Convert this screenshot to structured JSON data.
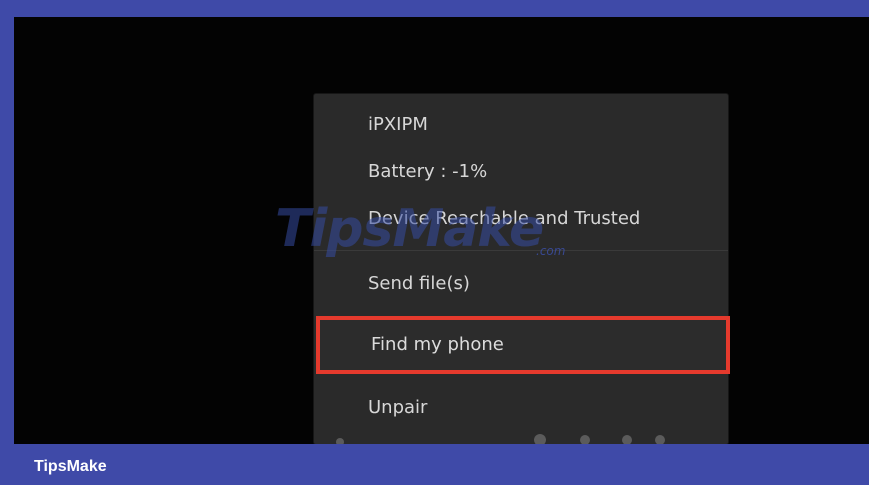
{
  "menu": {
    "items": [
      {
        "label": "iPXIPM"
      },
      {
        "label": "Battery : -1%"
      },
      {
        "label": "Device Reachable and Trusted"
      },
      {
        "label": "Send file(s)"
      },
      {
        "label": "Find my phone"
      },
      {
        "label": "Unpair"
      }
    ]
  },
  "watermark": {
    "text": "TipsMake",
    "suffix": ".com"
  },
  "footer": {
    "brand": "TipsMake"
  },
  "colors": {
    "frame": "#3f4aa8",
    "screen": "#030303",
    "menu": "#2a2a2a",
    "highlight_border": "#e53a2d"
  }
}
